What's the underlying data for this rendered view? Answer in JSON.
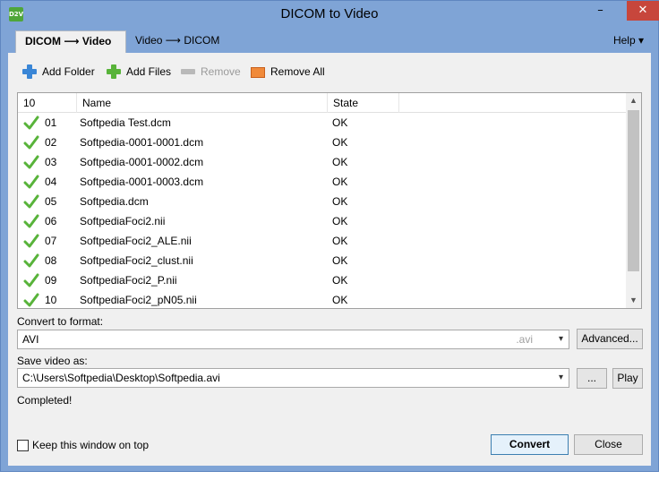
{
  "window": {
    "title": "DICOM to Video",
    "app_icon_text": "D2V",
    "controls": {
      "minimize": "–",
      "maximize": "□",
      "close": "✕"
    }
  },
  "tabs": [
    {
      "label": "DICOM ⟶ Video",
      "active": true
    },
    {
      "label": "Video ⟶ DICOM",
      "active": false
    }
  ],
  "help_menu": "Help ▾",
  "toolbar": {
    "add_folder": "Add Folder",
    "add_files": "Add Files",
    "remove": "Remove",
    "remove_all": "Remove All"
  },
  "file_list": {
    "columns": [
      "10",
      "Name",
      "State"
    ],
    "rows": [
      {
        "num": "01",
        "name": "Softpedia Test.dcm",
        "state": "OK"
      },
      {
        "num": "02",
        "name": "Softpedia-0001-0001.dcm",
        "state": "OK"
      },
      {
        "num": "03",
        "name": "Softpedia-0001-0002.dcm",
        "state": "OK"
      },
      {
        "num": "04",
        "name": "Softpedia-0001-0003.dcm",
        "state": "OK"
      },
      {
        "num": "05",
        "name": "Softpedia.dcm",
        "state": "OK"
      },
      {
        "num": "06",
        "name": "SoftpediaFoci2.nii",
        "state": "OK"
      },
      {
        "num": "07",
        "name": "SoftpediaFoci2_ALE.nii",
        "state": "OK"
      },
      {
        "num": "08",
        "name": "SoftpediaFoci2_clust.nii",
        "state": "OK"
      },
      {
        "num": "09",
        "name": "SoftpediaFoci2_P.nii",
        "state": "OK"
      },
      {
        "num": "10",
        "name": "SoftpediaFoci2_pN05.nii",
        "state": "OK"
      }
    ]
  },
  "convert": {
    "label": "Convert to format:",
    "value": "AVI",
    "hint": ".avi",
    "advanced_button": "Advanced..."
  },
  "save": {
    "label": "Save video as:",
    "value": "C:\\Users\\Softpedia\\Desktop\\Softpedia.avi",
    "browse_button": "...",
    "play_button": "Play"
  },
  "status": "Completed!",
  "footer": {
    "keep_on_top": "Keep this window on top",
    "convert_button": "Convert",
    "close_button": "Close"
  },
  "colors": {
    "frame": "#7fa4d6",
    "close_button": "#c7463c",
    "check_green": "#58b33a"
  }
}
